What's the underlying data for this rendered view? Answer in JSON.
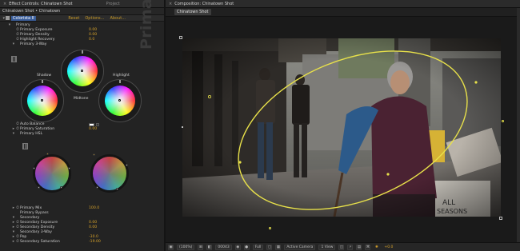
{
  "left_panel": {
    "tabs": [
      {
        "label": "Effect Controls: Chinatown Shot",
        "close": "×",
        "dim": false
      },
      {
        "label": "Project",
        "close": "",
        "dim": true
      }
    ],
    "breadcrumb": "Chinatown Shot • Chinatown",
    "effect": {
      "name": "Colorista II",
      "reset": "Reset",
      "options": "Options...",
      "about": "About..."
    },
    "rows": [
      {
        "tw": "▾",
        "sw": "",
        "label": "Primary",
        "value": "",
        "indent": 7
      },
      {
        "tw": "",
        "sw": "⏱",
        "label": "Primary Exposure",
        "value": "0.00",
        "indent": 12
      },
      {
        "tw": "",
        "sw": "⏱",
        "label": "Primary Density",
        "value": "0.00",
        "indent": 12
      },
      {
        "tw": "",
        "sw": "⏱",
        "label": "Highlight Recovery",
        "value": "0.0",
        "indent": 12
      },
      {
        "tw": "▾",
        "sw": "",
        "label": "Primary 3-Way",
        "value": "",
        "indent": 12
      }
    ],
    "three_way": {
      "shadow_label": "Shadow",
      "midtone_label": "Midtone",
      "highlight_label": "Highlight",
      "watermark": "Primary"
    },
    "rows2": [
      {
        "tw": "",
        "sw": "⏱",
        "label": "Auto Balance",
        "value": ""
      },
      {
        "tw": "▸",
        "sw": "⏱",
        "label": "Primary Saturation",
        "value": "0.00"
      },
      {
        "tw": "▾",
        "sw": "",
        "label": "Primary HSL",
        "value": ""
      }
    ],
    "rows3": [
      {
        "tw": "▸",
        "sw": "⏱",
        "label": "Primary Mix",
        "value": "100.0"
      },
      {
        "tw": "",
        "sw": "",
        "label": "Primary Bypass",
        "value": ""
      },
      {
        "tw": "▾",
        "sw": "",
        "label": "Secondary",
        "value": ""
      },
      {
        "tw": "▸",
        "sw": "⏱",
        "label": "Secondary Exposure",
        "value": "0.00"
      },
      {
        "tw": "▸",
        "sw": "⏱",
        "label": "Secondary Density",
        "value": "0.00"
      },
      {
        "tw": "▾",
        "sw": "",
        "label": "Secondary 3-Way",
        "value": ""
      },
      {
        "tw": "▸",
        "sw": "⏱",
        "label": "Pop",
        "value": "-30.0"
      },
      {
        "tw": "▸",
        "sw": "⏱",
        "label": "Secondary Saturation",
        "value": "-19.00"
      }
    ]
  },
  "right_panel": {
    "tabs": [
      {
        "label": "Composition: Chinatown Shot",
        "close": "×"
      }
    ],
    "comp_tab": "Chinatown Shot",
    "bottombar": {
      "zoom": "(100%)",
      "timecode": "00043",
      "resolution": "Full",
      "camera": "Active Camera",
      "views": "1 View",
      "exposure": "+0.0"
    }
  },
  "colors": {
    "accent_value": "#d5a12a",
    "selection_blue": "#3a5d9a",
    "mask_yellow": "#e8e14a"
  }
}
